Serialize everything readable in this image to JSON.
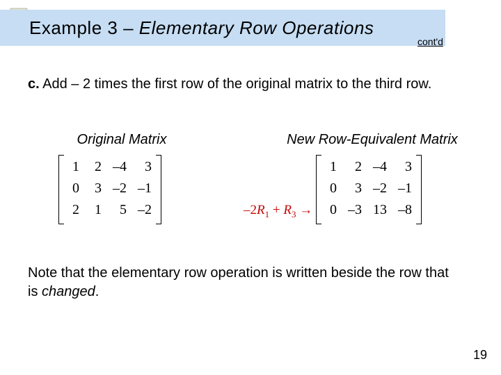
{
  "title": {
    "example_label": "Example 3",
    "separator": " – ",
    "title_text": "Elementary Row Operations"
  },
  "contd": "cont'd",
  "part_c": {
    "label": "c.",
    "text_before_num": " Add ",
    "num": "– 2",
    "text_after_num": " times the first row of the original matrix to the third row."
  },
  "headers": {
    "left": "Original Matrix",
    "right": "New Row-Equivalent Matrix"
  },
  "original_matrix": {
    "r1": {
      "c1": "1",
      "c2": "2",
      "c3": "–4",
      "c4": "3"
    },
    "r2": {
      "c1": "0",
      "c2": "3",
      "c3": "–2",
      "c4": "–1"
    },
    "r3": {
      "c1": "2",
      "c2": "1",
      "c3": "5",
      "c4": "–2"
    }
  },
  "row_op": {
    "prefix": "–2",
    "r1": "R",
    "sub1": "1",
    "plus": " + ",
    "r3": "R",
    "sub3": "3",
    "arrow": " →"
  },
  "new_matrix": {
    "r1": {
      "c1": "1",
      "c2": "2",
      "c3": "–4",
      "c4": "3"
    },
    "r2": {
      "c1": "0",
      "c2": "3",
      "c3": "–2",
      "c4": "–1"
    },
    "r3": {
      "c1": "0",
      "c2": "–3",
      "c3": "13",
      "c4": "–8"
    }
  },
  "note": {
    "text_before": "Note that the elementary row operation is written beside the row that is ",
    "changed": "changed",
    "period": "."
  },
  "page_number": "19"
}
